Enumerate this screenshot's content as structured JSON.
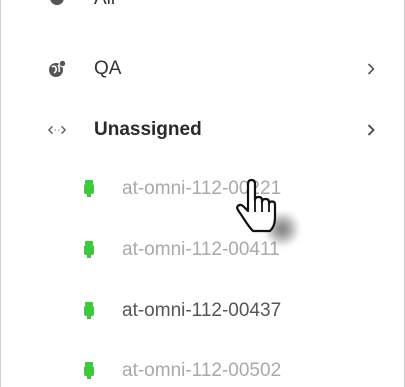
{
  "tree": {
    "partial_top": {
      "label": "All",
      "icon": "globe-icon"
    },
    "groups": [
      {
        "label": "QA",
        "icon": "globe-pin-icon",
        "chevron": "chevron-right-icon",
        "bold": false
      },
      {
        "label": "Unassigned",
        "icon": "unlinked-arrows-icon",
        "chevron": "chevron-right-icon",
        "bold": true
      }
    ],
    "devices": [
      {
        "label": "at-omni-112-00221",
        "icon": "device-plug-icon",
        "status": "online"
      },
      {
        "label": "at-omni-112-00411",
        "icon": "device-plug-icon",
        "status": "online"
      },
      {
        "label": "at-omni-112-00437",
        "icon": "device-plug-icon",
        "status": "online"
      },
      {
        "label": "at-omni-112-00502",
        "icon": "device-plug-icon",
        "status": "online"
      }
    ]
  },
  "colors": {
    "device_online": "#3ec83e",
    "icon_gray": "#555555",
    "chevron": "#555555"
  },
  "cursor": {
    "icon": "hand-pointer-cursor-icon"
  }
}
